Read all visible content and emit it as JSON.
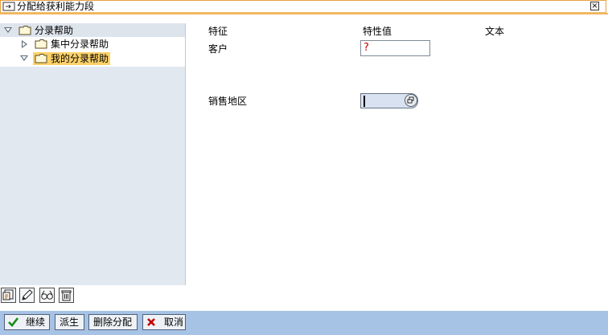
{
  "window": {
    "title": "分配给获利能力段"
  },
  "tree": {
    "root": {
      "label": "分录帮助",
      "expanded": true
    },
    "children": [
      {
        "label": "集中分录帮助",
        "expanded": false,
        "selected": false
      },
      {
        "label": "我的分录帮助",
        "expanded": true,
        "selected": true
      }
    ]
  },
  "form": {
    "headers": {
      "feature": "特征",
      "value": "特性值",
      "text": "文本"
    },
    "fields": [
      {
        "label": "客户",
        "value": "?",
        "required": true
      },
      {
        "label": "销售地区",
        "value": "",
        "focused": true,
        "has_f4_help": true
      }
    ]
  },
  "tree_toolbar": {
    "icons": [
      "details-icon",
      "edit-pencil-icon",
      "glasses-display-icon",
      "trash-icon"
    ]
  },
  "footer": {
    "continue": "继续",
    "derive": "派生",
    "delete_assignment": "删除分配",
    "cancel": "取消"
  },
  "colors": {
    "selection": "#fdd26a",
    "footer_bg": "#a6c2e4",
    "title_accent": "#f2b45a",
    "required_mark": "#c00000",
    "continue_check": "#1a8a1a",
    "cancel_x": "#c00000"
  }
}
